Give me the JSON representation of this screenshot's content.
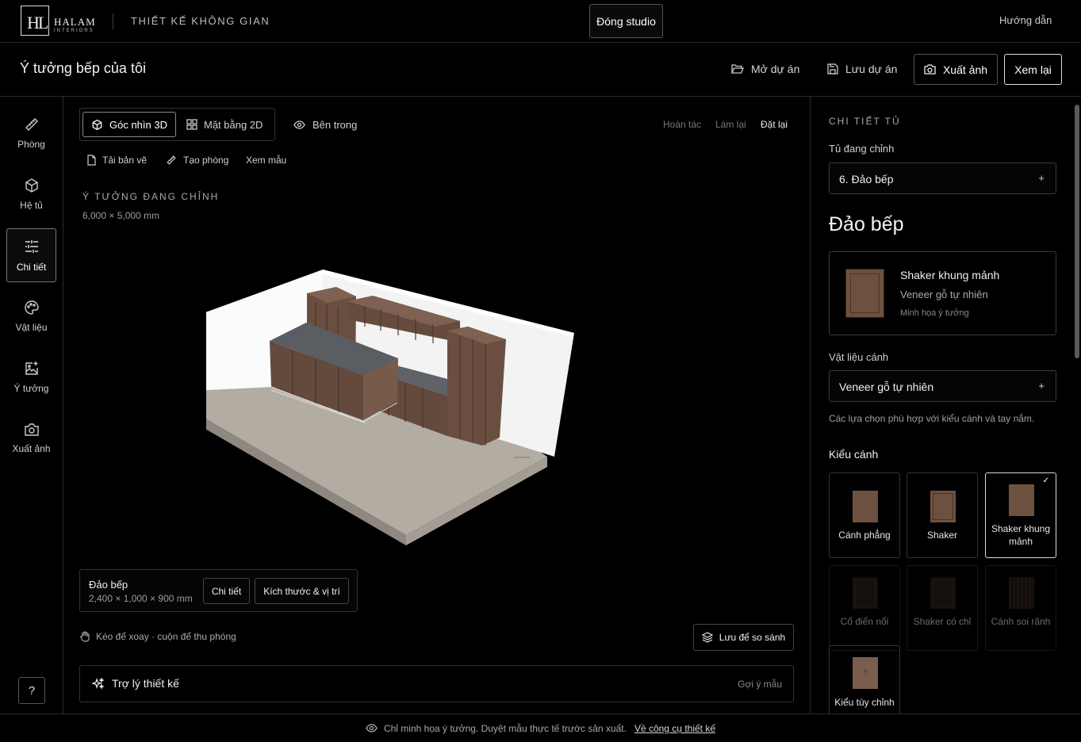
{
  "brand": {
    "mark": "HL",
    "name": "HALAM",
    "sub": "INTERIORS"
  },
  "header": {
    "studio_name": "THIẾT KẾ KHÔNG GIAN",
    "close_label": "Đóng studio",
    "guide_label": "Hướng dẫn"
  },
  "project": {
    "title": "Ý tưởng bếp của tôi",
    "open_label": "Mở dự án",
    "save_label": "Lưu dự án",
    "export_label": "Xuất ảnh",
    "review_label": "Xem lại"
  },
  "rail": {
    "items": [
      {
        "label": "Phòng",
        "icon": "ruler-icon"
      },
      {
        "label": "Hệ tủ",
        "icon": "cube-icon"
      },
      {
        "label": "Chi tiết",
        "icon": "sliders-icon",
        "active": true
      },
      {
        "label": "Vật liệu",
        "icon": "palette-icon"
      },
      {
        "label": "Ý tưởng",
        "icon": "image-spark-icon"
      },
      {
        "label": "Xuất ảnh",
        "icon": "camera-icon"
      }
    ],
    "help": "?"
  },
  "viewer": {
    "tabs": [
      {
        "label": "Góc nhìn 3D",
        "active": true
      },
      {
        "label": "Mặt bằng 2D"
      }
    ],
    "inside_label": "Bên trong",
    "undo": "Hoàn tác",
    "redo": "Làm lại",
    "reset": "Đặt lại",
    "reupload": "Tải bản vẽ",
    "create_room": "Tạo phòng",
    "samples": "Xem mẫu",
    "editing_label": "Ý TƯỞNG ĐANG CHỈNH",
    "room_dims": "6,000 × 5,000 mm",
    "selection": {
      "name": "Đảo bếp",
      "dims": "2,400 × 1,000 × 900 mm",
      "detail_btn": "Chi tiết",
      "size_btn": "Kích thước & vị trí"
    },
    "hint": "Kéo để xoay · cuộn để thu phóng",
    "compare_btn": "Lưu để so sánh",
    "assistant": {
      "label": "Trợ lý thiết kế",
      "hint": "Gợi ý mẫu"
    }
  },
  "panel": {
    "heading": "CHI TIẾT TỦ",
    "cab_label": "Tủ đang chỉnh",
    "cab_value": "6. Đảo bếp",
    "cab_title": "Đảo bếp",
    "style": {
      "name": "Shaker khung mảnh",
      "material": "Veneer gỗ tự nhiên",
      "note": "Minh họa ý tưởng"
    },
    "material_label": "Vật liệu cánh",
    "material_value": "Veneer gỗ tự nhiên",
    "material_hint": "Các lựa chọn phù hợp với kiểu cánh và tay nắm.",
    "door_heading": "Kiểu cánh",
    "doors": [
      {
        "label": "Cánh phẳng"
      },
      {
        "label": "Shaker"
      },
      {
        "label": "Shaker khung mảnh",
        "selected": true
      },
      {
        "label": "Cổ điển nổi",
        "disabled": true
      },
      {
        "label": "Shaker có chỉ",
        "disabled": true
      },
      {
        "label": "Cánh soi rãnh",
        "disabled": true
      },
      {
        "label": "Kiểu tùy chỉnh",
        "thumb_mark": "?"
      }
    ],
    "plus": "+"
  },
  "footer": {
    "text": "Chỉ minh họa ý tưởng. Duyệt mẫu thực tế trước sản xuất.",
    "link": "Về công cụ thiết kế"
  },
  "colors": {
    "background": "#000000",
    "wood": "#6d5140",
    "counter": "#5a5e63",
    "floor": "#b3aca2",
    "wall": "#ffffff"
  }
}
